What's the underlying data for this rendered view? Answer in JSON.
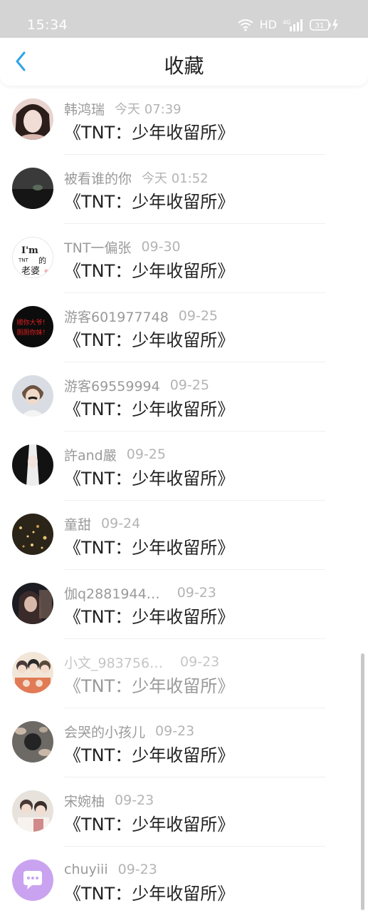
{
  "status_bar": {
    "time": "15:34",
    "network_label": "HD",
    "signal_label": "4G",
    "battery_level": "31"
  },
  "nav": {
    "title": "收藏"
  },
  "items": [
    {
      "name": "韩鸿瑞",
      "time": "今天 07:39",
      "title": "《TNT：少年收留所》",
      "avatar_colors": [
        "#e8d3cf",
        "#2b1d1a"
      ]
    },
    {
      "name": "被看谁的你",
      "time": "今天 01:52",
      "title": "《TNT：少年收留所》",
      "avatar_colors": [
        "#3a3a3a",
        "#151515"
      ]
    },
    {
      "name": "TNT一偏张",
      "time": "09-30",
      "title": "《TNT：少年收留所》",
      "avatar_text": "I'm TNT 的 老婆",
      "avatar_colors": [
        "#ffffff",
        "#222222"
      ]
    },
    {
      "name": "游客601977748",
      "time": "09-25",
      "title": "《TNT：少年收留所》",
      "avatar_text": "顺你大爷！ 厕厕你妹！",
      "avatar_colors": [
        "#0c0c0c",
        "#e02020"
      ]
    },
    {
      "name": "游客69559994",
      "time": "09-25",
      "title": "《TNT：少年收留所》",
      "avatar_colors": [
        "#d9dde3",
        "#6b5340"
      ]
    },
    {
      "name": "許and嚴",
      "time": "09-25",
      "title": "《TNT：少年收留所》",
      "avatar_colors": [
        "#ededed",
        "#121212"
      ]
    },
    {
      "name": "童甜",
      "time": "09-24",
      "title": "《TNT：少年收留所》",
      "avatar_colors": [
        "#2b2418",
        "#c89a4a"
      ]
    },
    {
      "name": "伽q2881944…",
      "time": "09-23",
      "title": "《TNT：少年收留所》",
      "avatar_colors": [
        "#1c1c22",
        "#9a7a6a"
      ]
    },
    {
      "name": "小文_983756…",
      "time": "09-23",
      "title": "《TNT：少年收留所》",
      "avatar_colors": [
        "#f2e6d8",
        "#e07b55"
      ]
    },
    {
      "name": "会哭的小孩儿",
      "time": "09-23",
      "title": "《TNT：少年收留所》",
      "avatar_colors": [
        "#6d6a66",
        "#242424"
      ]
    },
    {
      "name": "宋婉柚",
      "time": "09-23",
      "title": "《TNT：少年收留所》",
      "avatar_colors": [
        "#e7e2dc",
        "#4a3a35"
      ]
    },
    {
      "name": "chuyiii",
      "time": "09-23",
      "title": "《TNT：少年收留所》",
      "avatar_colors": [
        "#c9a3f0",
        "#ffffff"
      ]
    }
  ],
  "colors": {
    "accent": "#2ea3e8",
    "status_bar_bg": "#d4d4d4",
    "title_text": "#222222",
    "meta_text": "#9a9a9a"
  }
}
